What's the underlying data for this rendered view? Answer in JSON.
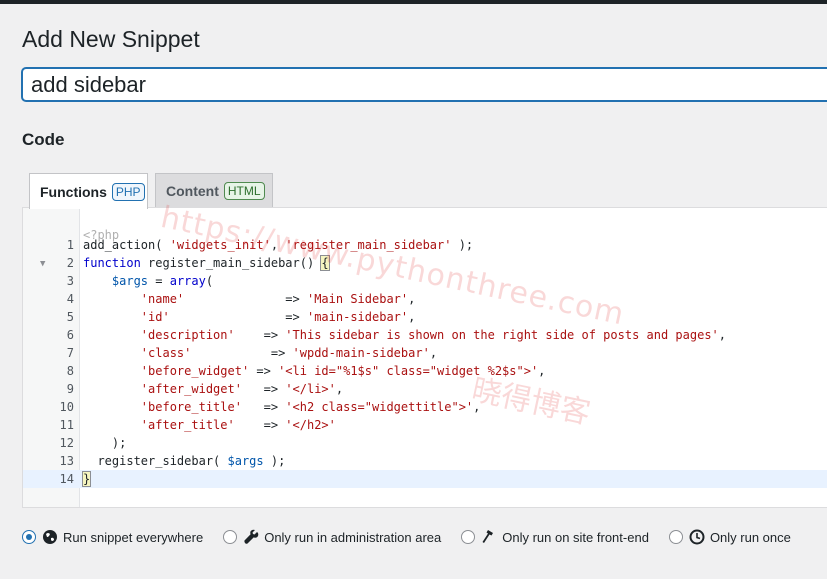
{
  "page": {
    "title": "Add New Snippet"
  },
  "snippet_title": {
    "value": "add sidebar"
  },
  "code_section": {
    "label": "Code",
    "tabs": [
      {
        "label": "Functions",
        "badge": "PHP",
        "active": true
      },
      {
        "label": "Content",
        "badge": "HTML",
        "active": false
      }
    ],
    "header_line": "<?php",
    "lines": [
      "add_action( 'widgets_init', 'register_main_sidebar' );",
      "function register_main_sidebar() {",
      "    $args = array(",
      "        'name'              => 'Main Sidebar',",
      "        'id'                => 'main-sidebar',",
      "        'description'    => 'This sidebar is shown on the right side of posts and pages',",
      "        'class'           => 'wpdd-main-sidebar',",
      "        'before_widget' => '<li id=\"%1$s\" class=\"widget %2$s\">',",
      "        'after_widget'   => '</li>',",
      "        'before_title'   => '<h2 class=\"widgettitle\">',",
      "        'after_title'    => '</h2>'",
      "    );",
      "  register_sidebar( $args );",
      "}"
    ],
    "line_numbers": [
      "1",
      "2",
      "3",
      "4",
      "5",
      "6",
      "7",
      "8",
      "9",
      "10",
      "11",
      "12",
      "13",
      "14"
    ],
    "active_line": 14
  },
  "watermark": {
    "line1": "https://www.pythonthree.com",
    "line2": "晓得博客"
  },
  "scope_options": [
    {
      "label": "Run snippet everywhere",
      "icon": "globe-icon",
      "checked": true
    },
    {
      "label": "Only run in administration area",
      "icon": "wrench-icon",
      "checked": false
    },
    {
      "label": "Only run on site front-end",
      "icon": "hammer-icon",
      "checked": false
    },
    {
      "label": "Only run once",
      "icon": "clock-icon",
      "checked": false
    }
  ],
  "colors": {
    "accent": "#2271b1",
    "string": "#aa1111",
    "keyword": "#0000cc"
  }
}
